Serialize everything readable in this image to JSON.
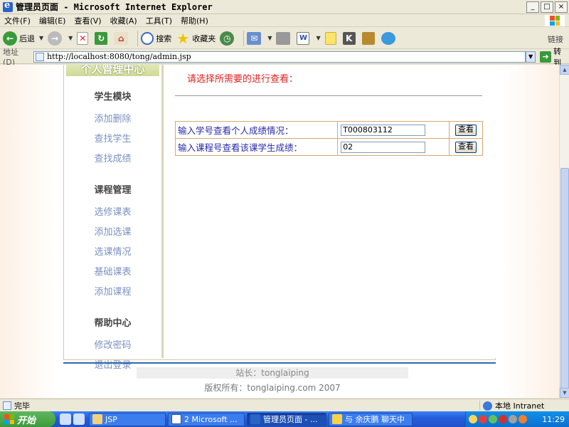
{
  "window": {
    "title": "管理员页面 - Microsoft Internet Explorer",
    "controls": [
      "_",
      "□",
      "×"
    ]
  },
  "menubar": {
    "items": [
      "文件(F)",
      "编辑(E)",
      "查看(V)",
      "收藏(A)",
      "工具(T)",
      "帮助(H)"
    ]
  },
  "toolbar": {
    "back_label": "后退",
    "search_label": "搜索",
    "favorites_label": "收藏夹",
    "links_label": "链接"
  },
  "address": {
    "label": "地址(D)",
    "url": "http://localhost:8080/tong/admin.jsp",
    "go_label": "转到"
  },
  "sidebar": {
    "header": "个人管理中心",
    "sections": [
      {
        "title": "学生模块",
        "links": [
          "添加删除",
          "查找学生",
          "查找成绩"
        ]
      },
      {
        "title": "课程管理",
        "links": [
          "选修课表",
          "添加选课",
          "选课情况",
          "基础课表",
          "添加课程"
        ]
      },
      {
        "title": "帮助中心",
        "links": [
          "修改密码",
          "退出登录"
        ]
      }
    ]
  },
  "main": {
    "prompt": "请选择所需要的进行查看：",
    "queries": [
      {
        "label": "输入学号查看个人成绩情况：",
        "value": "T000803112",
        "button": "查看"
      },
      {
        "label": "输入课程号查看该课学生成绩：",
        "value": "02",
        "button": "查看"
      }
    ]
  },
  "footer": {
    "webmaster": "站长：tonglaiping",
    "copyright": "版权所有：tonglaiping.com 2007"
  },
  "statusbar": {
    "status": "完毕",
    "zone": "本地 Intranet"
  },
  "taskbar": {
    "start_label": "开始",
    "tasks": [
      {
        "label": "JSP",
        "icon": "folder-icon"
      },
      {
        "label": "2 Microsoft ...",
        "icon": "word-icon"
      },
      {
        "label": "管理员页面 - ...",
        "icon": "ie-icon"
      },
      {
        "label": "与 余庆鹏 聊天中",
        "icon": "chat-icon"
      }
    ],
    "clock": "11:29"
  }
}
